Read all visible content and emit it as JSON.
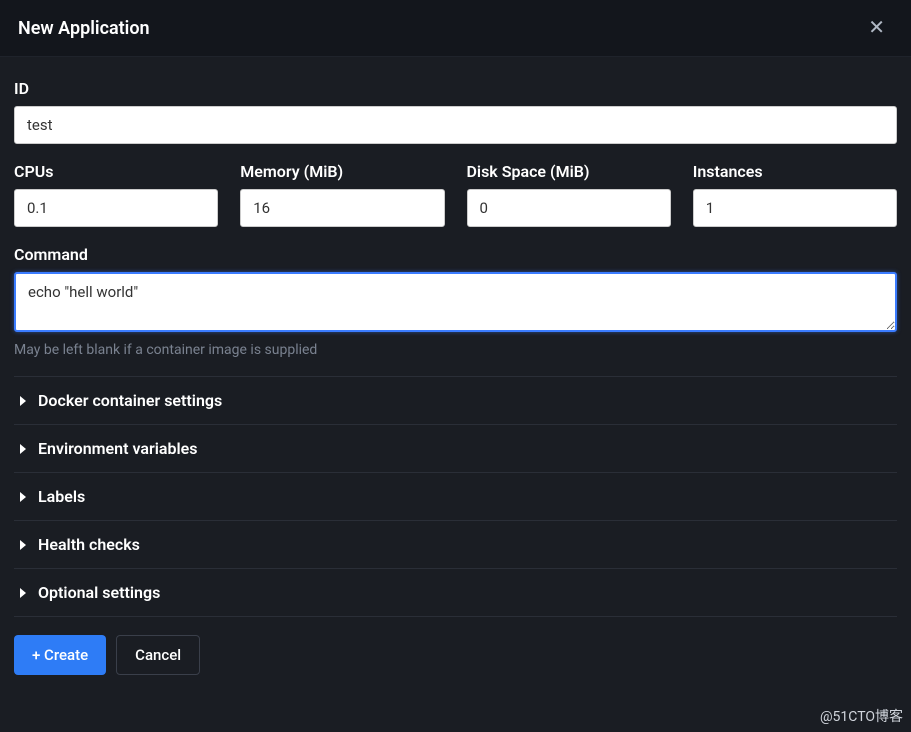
{
  "header": {
    "title": "New Application"
  },
  "form": {
    "id": {
      "label": "ID",
      "value": "test"
    },
    "cpus": {
      "label": "CPUs",
      "value": "0.1"
    },
    "memory": {
      "label": "Memory (MiB)",
      "value": "16"
    },
    "disk": {
      "label": "Disk Space (MiB)",
      "value": "0"
    },
    "instances": {
      "label": "Instances",
      "value": "1"
    },
    "command": {
      "label": "Command",
      "value": "echo \"hell world\"",
      "helper": "May be left blank if a container image is supplied"
    }
  },
  "sections": {
    "docker": "Docker container settings",
    "env": "Environment variables",
    "labels": "Labels",
    "health": "Health checks",
    "optional": "Optional settings"
  },
  "actions": {
    "create": "+ Create",
    "cancel": "Cancel"
  },
  "watermark": "@51CTO博客"
}
